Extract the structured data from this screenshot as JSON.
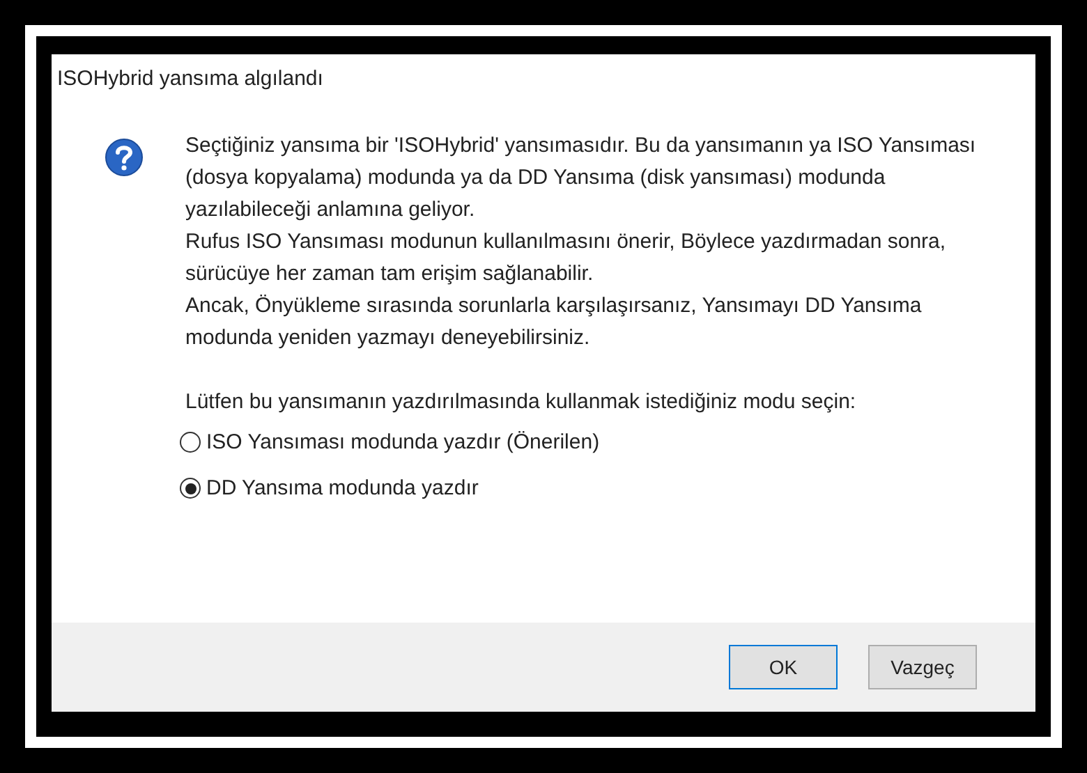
{
  "window": {
    "title": "ISOHybrid yansıma algılandı"
  },
  "message": [
    "Seçtiğiniz yansıma bir 'ISOHybrid' yansımasıdır. Bu da yansımanın ya ISO Yansıması (dosya kopyalama) modunda ya da DD Yansıma (disk yansıması) modunda yazılabileceği anlamına geliyor.",
    "Rufus ISO Yansıması modunun kullanılmasını önerir, Böylece yazdırmadan sonra, sürücüye her zaman tam erişim sağlanabilir.",
    "Ancak, Önyükleme sırasında sorunlarla karşılaşırsanız, Yansımayı DD Yansıma modunda yeniden yazmayı deneyebilirsiniz."
  ],
  "prompt": "Lütfen bu yansımanın yazdırılmasında kullanmak istediğiniz modu seçin:",
  "options": [
    {
      "label": "ISO Yansıması modunda yazdır (Önerilen)",
      "selected": false
    },
    {
      "label": "DD Yansıma modunda yazdır",
      "selected": true
    }
  ],
  "buttons": [
    "OK",
    "Vazgeç"
  ]
}
